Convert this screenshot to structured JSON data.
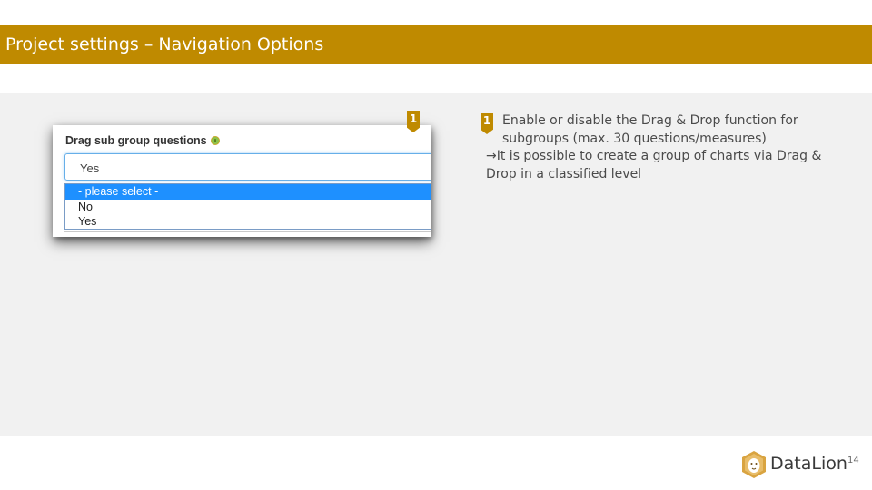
{
  "header": {
    "title": "Project settings – Navigation Options"
  },
  "screenshot": {
    "badge": "1",
    "field_label": "Drag sub group questions",
    "select_value": "Yes",
    "options": [
      "- please select -",
      "No",
      "Yes"
    ],
    "highlighted_option": "- please select -"
  },
  "note": {
    "badge": "1",
    "line1": "Enable or disable the Drag & Drop function for subgroups (max. 30 questions/measures)",
    "line2": "→It is possible to create a group of charts via Drag & Drop in a classified level"
  },
  "footer": {
    "brand": "DataLion",
    "page_number": "14"
  },
  "colors": {
    "accent": "#bf8a00",
    "panel": "#f1f1f1",
    "selection": "#1e90ff"
  }
}
